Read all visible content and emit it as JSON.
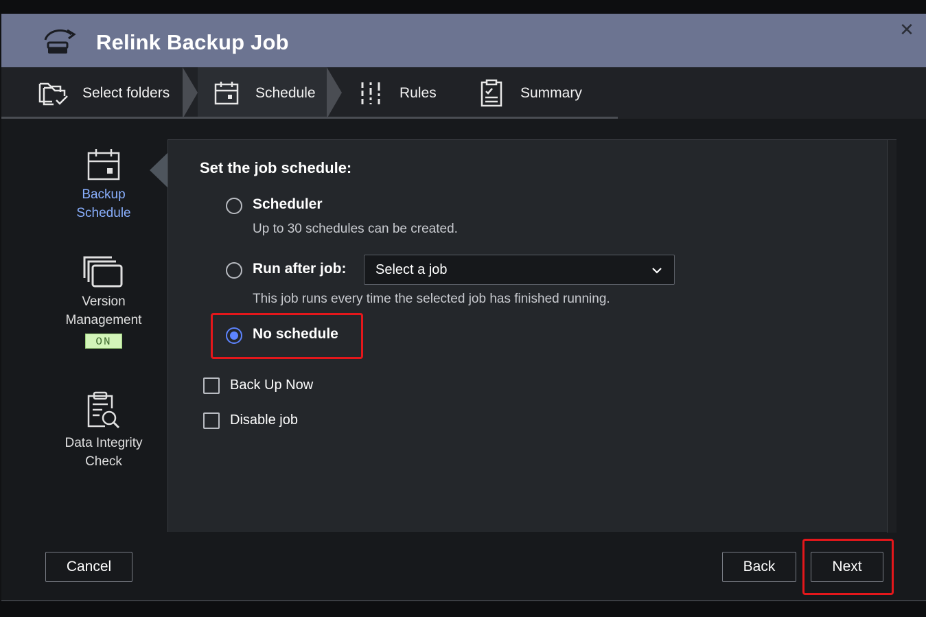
{
  "dialog": {
    "title": "Relink Backup Job",
    "title_icon": "backup-sync-icon",
    "close_icon": "close-icon",
    "close_glyph": "✕"
  },
  "steps": [
    {
      "label": "Select folders",
      "icon": "folder-check-icon"
    },
    {
      "label": "Schedule",
      "icon": "calendar-icon",
      "active": true
    },
    {
      "label": "Rules",
      "icon": "sliders-icon"
    },
    {
      "label": "Summary",
      "icon": "clipboard-checklist-icon"
    }
  ],
  "sidebar": {
    "items": [
      {
        "line1": "Backup",
        "line2": "Schedule",
        "icon": "calendar-icon",
        "active": true
      },
      {
        "line1": "Version",
        "line2": "Management",
        "icon": "versions-icon",
        "badge": "ON"
      },
      {
        "line1": "Data Integrity",
        "line2": "Check",
        "icon": "clipboard-search-icon"
      }
    ]
  },
  "main": {
    "heading": "Set the job schedule:",
    "options": {
      "scheduler": {
        "label": "Scheduler",
        "desc": "Up to 30 schedules can be created.",
        "checked": false
      },
      "run_after": {
        "label": "Run after job:",
        "desc": "This job runs every time the selected job has finished running.",
        "checked": false,
        "select_value": "Select a job"
      },
      "no_schedule": {
        "label": "No schedule",
        "checked": true
      }
    },
    "checkboxes": {
      "backup_now": {
        "label": "Back Up Now",
        "checked": false
      },
      "disable_job": {
        "label": "Disable job",
        "checked": false
      }
    }
  },
  "footer": {
    "cancel": "Cancel",
    "back": "Back",
    "next": "Next"
  },
  "colors": {
    "titlebar": "#6c7491",
    "accent": "#5d84ff",
    "highlight": "#e4171b",
    "badge_bg": "#d3f5b9"
  }
}
